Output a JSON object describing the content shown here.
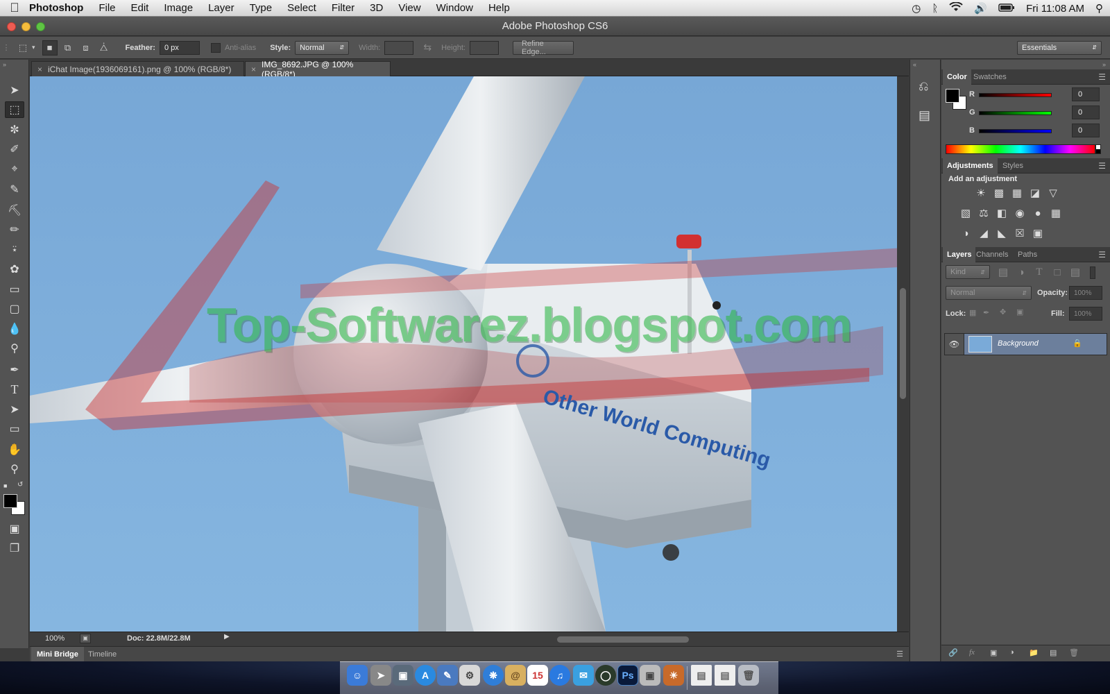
{
  "menubar": {
    "app_name": "Photoshop",
    "menus": [
      "File",
      "Edit",
      "Image",
      "Layer",
      "Type",
      "Select",
      "Filter",
      "3D",
      "View",
      "Window",
      "Help"
    ],
    "clock": "Fri 11:08 AM"
  },
  "window": {
    "title": "Adobe Photoshop CS6"
  },
  "options_bar": {
    "feather_label": "Feather:",
    "feather_value": "0 px",
    "antialias_label": "Anti-alias",
    "style_label": "Style:",
    "style_value": "Normal",
    "width_label": "Width:",
    "height_label": "Height:",
    "refine_edge_label": "Refine Edge...",
    "workspace_value": "Essentials"
  },
  "document_tabs": [
    {
      "label": "iChat Image(1936069161).png @ 100% (RGB/8*)",
      "active": false
    },
    {
      "label": "IMG_8692.JPG @ 100% (RGB/8*)",
      "active": true
    }
  ],
  "canvas": {
    "watermark_text": "Top-Softwarez.blogspot.com",
    "nacelle_text": "Other World Computing"
  },
  "status_bar": {
    "zoom": "100%",
    "doc_info": "Doc: 22.8M/22.8M"
  },
  "bottom_tabs": [
    "Mini Bridge",
    "Timeline"
  ],
  "color_panel": {
    "tabs": [
      "Color",
      "Swatches"
    ],
    "r_label": "R",
    "r_value": "0",
    "g_label": "G",
    "g_value": "0",
    "b_label": "B",
    "b_value": "0"
  },
  "adjustments_panel": {
    "tabs": [
      "Adjustments",
      "Styles"
    ],
    "heading": "Add an adjustment"
  },
  "layers_panel": {
    "tabs": [
      "Layers",
      "Channels",
      "Paths"
    ],
    "filter_kind": "Kind",
    "blend_mode": "Normal",
    "opacity_label": "Opacity:",
    "opacity_value": "100%",
    "lock_label": "Lock:",
    "fill_label": "Fill:",
    "fill_value": "100%",
    "layers": [
      {
        "name": "Background",
        "visible": true,
        "locked": true
      }
    ]
  },
  "colors": {
    "ui_bg": "#535353",
    "sky": "#7aaad8",
    "layer_selected": "#6c7f9c"
  }
}
